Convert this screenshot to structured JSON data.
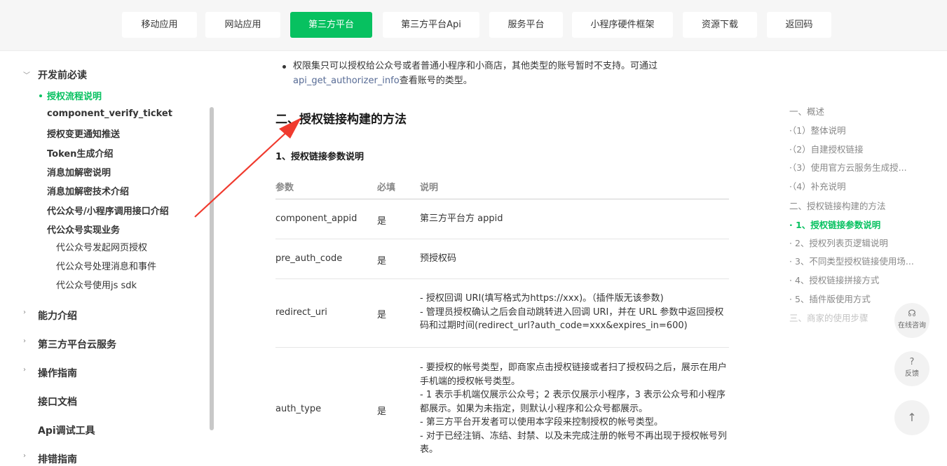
{
  "top_tabs": [
    "移动应用",
    "网站应用",
    "第三方平台",
    "第三方平台Api",
    "服务平台",
    "小程序硬件框架",
    "资源下载",
    "返回码"
  ],
  "active_tab": "第三方平台",
  "sidebar": {
    "group_open": "开发前必读",
    "items": [
      "授权流程说明",
      "component_verify_ticket",
      "授权变更通知推送",
      "Token生成介绍",
      "消息加解密说明",
      "消息加解密技术介绍",
      "代公众号/小程序调用接口介绍",
      "代公众号实现业务"
    ],
    "sub_items": [
      "代公众号发起网页授权",
      "代公众号处理消息和事件",
      "代公众号使用js sdk"
    ],
    "groups": [
      "能力介绍",
      "第三方平台云服务",
      "操作指南",
      "接口文档",
      "Api调试工具",
      "排错指南"
    ]
  },
  "content": {
    "para_prefix": "权限集只可以授权给公众号或者普通小程序和小商店，其他类型的账号暂时不支持。可通过",
    "para_link": "api_get_authorizer_info",
    "para_suffix": "查看账号的类型。",
    "h2": "二、授权链接构建的方法",
    "h3": "1、授权链接参数说明",
    "table_headers": [
      "参数",
      "必填",
      "说明"
    ],
    "rows": [
      {
        "param": "component_appid",
        "required": "是",
        "desc": [
          "第三方平台方 appid"
        ]
      },
      {
        "param": "pre_auth_code",
        "required": "是",
        "desc": [
          "预授权码"
        ]
      },
      {
        "param": "redirect_uri",
        "required": "是",
        "desc": [
          "- 授权回调 URI(填写格式为https://xxx)。（插件版无该参数)",
          "- 管理员授权确认之后会自动跳转进入回调 URI，并在 URL 参数中返回授权码和过期时间(redirect_url?auth_code=xxx&expires_in=600)"
        ]
      },
      {
        "param": "auth_type",
        "required": "是",
        "desc": [
          "- 要授权的帐号类型，即商家点击授权链接或者扫了授权码之后，展示在用户手机端的授权帐号类型。",
          "- 1 表示手机端仅展示公众号；2 表示仅展示小程序，3 表示公众号和小程序都展示。如果为未指定，则默认小程序和公众号都展示。",
          "- 第三方平台开发者可以使用本字段来控制授权的帐号类型。",
          "- 对于已经注销、冻结、封禁、以及未完成注册的帐号不再出现于授权帐号列表。"
        ]
      }
    ]
  },
  "toc": [
    "一、概述",
    "·（1）整体说明",
    "·（2）自建授权链接",
    "·（3）使用官方云服务生成授...",
    "·（4）补充说明",
    "二、授权链接构建的方法",
    "· 1、授权链接参数说明",
    "· 2、授权列表页逻辑说明",
    "· 3、不同类型授权链接使用场...",
    "· 4、授权链接拼接方式",
    "· 5、插件版使用方式",
    "三、商家的使用步骤"
  ],
  "toc_active_index": 6,
  "fabs": {
    "consult": "在线咨询",
    "feedback": "反馈"
  },
  "accent": "#07c160",
  "annotation_color": "#f03a2e"
}
